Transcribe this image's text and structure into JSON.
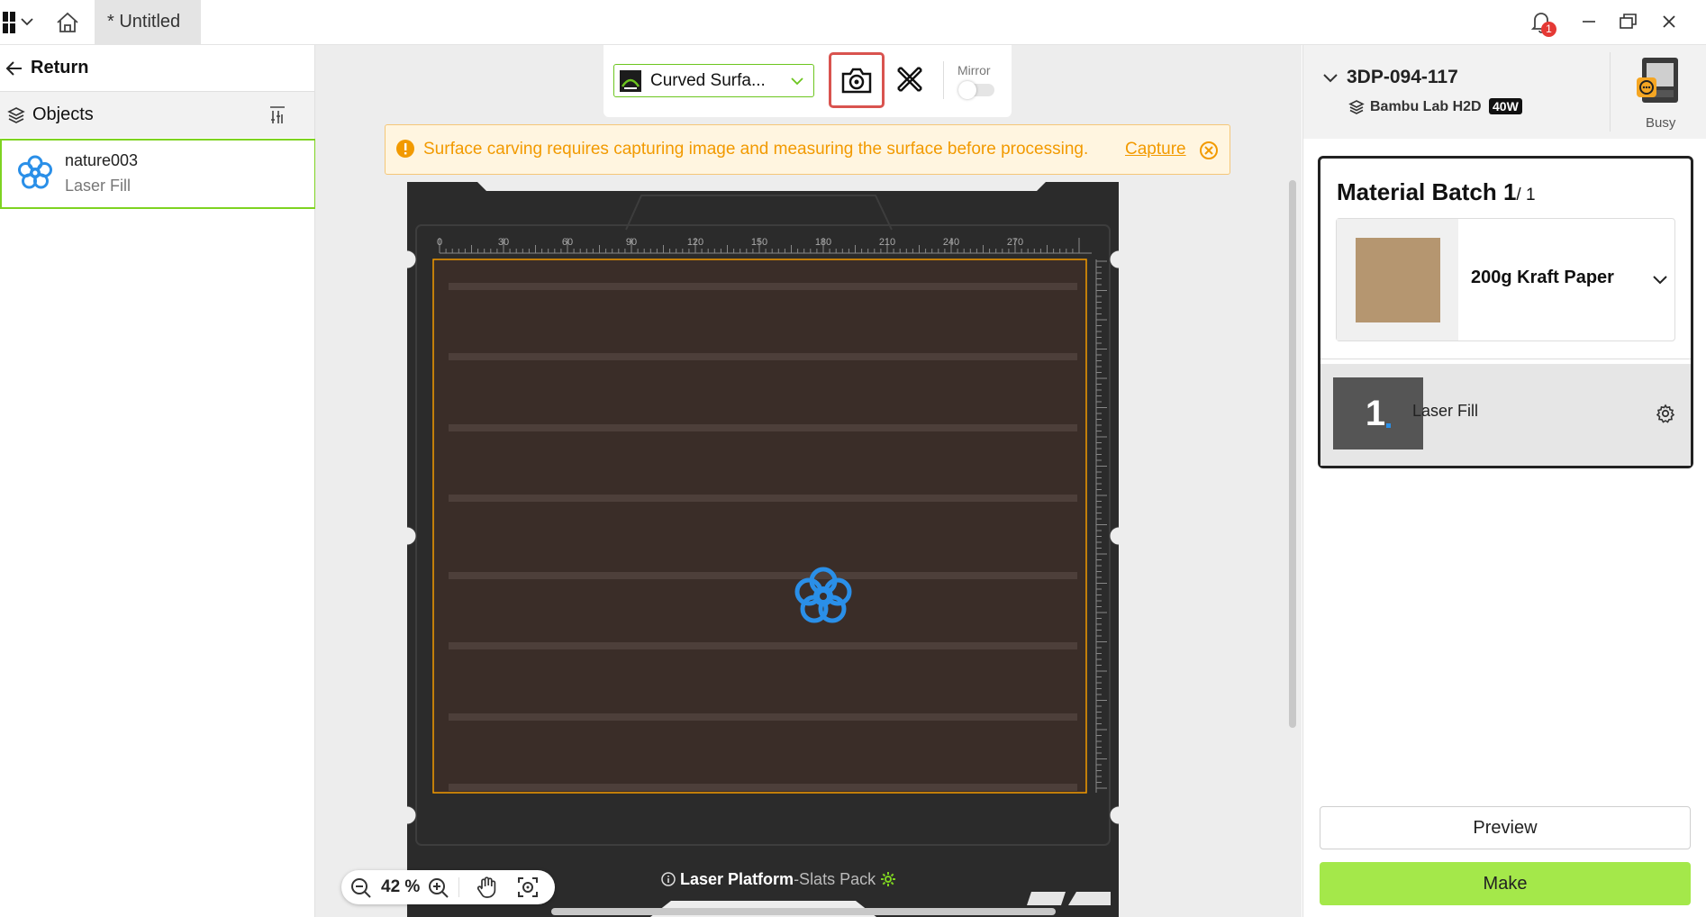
{
  "titlebar": {
    "tab_title": "* Untitled",
    "notification_count": "1"
  },
  "left_panel": {
    "return_label": "Return",
    "objects_label": "Objects",
    "objects": [
      {
        "name": "nature003",
        "type": "Laser Fill"
      }
    ]
  },
  "toolbar": {
    "mode_label": "Curved Surfa...",
    "mirror_label": "Mirror"
  },
  "warning": {
    "message": "Surface carving requires capturing image and measuring the surface before processing.",
    "action_label": "Capture"
  },
  "canvas": {
    "ruler_ticks": [
      "0",
      "30",
      "60",
      "90",
      "120",
      "150",
      "180",
      "210",
      "240",
      "270"
    ],
    "platform_name": "Laser Platform",
    "platform_variant": "-Slats Pack",
    "zoom": "42 %",
    "colors": {
      "platform": "#2b2b2b",
      "bed": "#3a2d28",
      "work_area_border": "#f29a00",
      "object": "#2a8fe8"
    }
  },
  "right_panel": {
    "device_name": "3DP-094-117",
    "device_model": "Bambu Lab H2D",
    "device_power": "40W",
    "device_status": "Busy",
    "batch_title": "Material Batch 1",
    "batch_count": "/ 1",
    "material_name": "200g Kraft Paper",
    "layer_number": "1",
    "layer_label": "Laser Fill",
    "preview_label": "Preview",
    "make_label": "Make",
    "colors": {
      "make_button": "#a4e84a",
      "kraft": "#b59670"
    }
  }
}
